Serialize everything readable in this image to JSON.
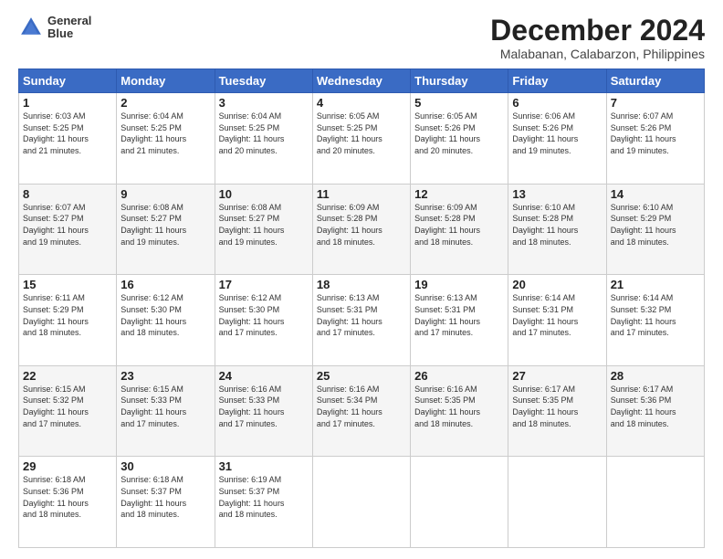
{
  "header": {
    "logo_line1": "General",
    "logo_line2": "Blue",
    "title": "December 2024",
    "subtitle": "Malabanan, Calabarzon, Philippines"
  },
  "calendar": {
    "days_of_week": [
      "Sunday",
      "Monday",
      "Tuesday",
      "Wednesday",
      "Thursday",
      "Friday",
      "Saturday"
    ],
    "weeks": [
      [
        {
          "day": 1,
          "info": "Sunrise: 6:03 AM\nSunset: 5:25 PM\nDaylight: 11 hours\nand 21 minutes."
        },
        {
          "day": 2,
          "info": "Sunrise: 6:04 AM\nSunset: 5:25 PM\nDaylight: 11 hours\nand 21 minutes."
        },
        {
          "day": 3,
          "info": "Sunrise: 6:04 AM\nSunset: 5:25 PM\nDaylight: 11 hours\nand 20 minutes."
        },
        {
          "day": 4,
          "info": "Sunrise: 6:05 AM\nSunset: 5:25 PM\nDaylight: 11 hours\nand 20 minutes."
        },
        {
          "day": 5,
          "info": "Sunrise: 6:05 AM\nSunset: 5:26 PM\nDaylight: 11 hours\nand 20 minutes."
        },
        {
          "day": 6,
          "info": "Sunrise: 6:06 AM\nSunset: 5:26 PM\nDaylight: 11 hours\nand 19 minutes."
        },
        {
          "day": 7,
          "info": "Sunrise: 6:07 AM\nSunset: 5:26 PM\nDaylight: 11 hours\nand 19 minutes."
        }
      ],
      [
        {
          "day": 8,
          "info": "Sunrise: 6:07 AM\nSunset: 5:27 PM\nDaylight: 11 hours\nand 19 minutes."
        },
        {
          "day": 9,
          "info": "Sunrise: 6:08 AM\nSunset: 5:27 PM\nDaylight: 11 hours\nand 19 minutes."
        },
        {
          "day": 10,
          "info": "Sunrise: 6:08 AM\nSunset: 5:27 PM\nDaylight: 11 hours\nand 19 minutes."
        },
        {
          "day": 11,
          "info": "Sunrise: 6:09 AM\nSunset: 5:28 PM\nDaylight: 11 hours\nand 18 minutes."
        },
        {
          "day": 12,
          "info": "Sunrise: 6:09 AM\nSunset: 5:28 PM\nDaylight: 11 hours\nand 18 minutes."
        },
        {
          "day": 13,
          "info": "Sunrise: 6:10 AM\nSunset: 5:28 PM\nDaylight: 11 hours\nand 18 minutes."
        },
        {
          "day": 14,
          "info": "Sunrise: 6:10 AM\nSunset: 5:29 PM\nDaylight: 11 hours\nand 18 minutes."
        }
      ],
      [
        {
          "day": 15,
          "info": "Sunrise: 6:11 AM\nSunset: 5:29 PM\nDaylight: 11 hours\nand 18 minutes."
        },
        {
          "day": 16,
          "info": "Sunrise: 6:12 AM\nSunset: 5:30 PM\nDaylight: 11 hours\nand 18 minutes."
        },
        {
          "day": 17,
          "info": "Sunrise: 6:12 AM\nSunset: 5:30 PM\nDaylight: 11 hours\nand 17 minutes."
        },
        {
          "day": 18,
          "info": "Sunrise: 6:13 AM\nSunset: 5:31 PM\nDaylight: 11 hours\nand 17 minutes."
        },
        {
          "day": 19,
          "info": "Sunrise: 6:13 AM\nSunset: 5:31 PM\nDaylight: 11 hours\nand 17 minutes."
        },
        {
          "day": 20,
          "info": "Sunrise: 6:14 AM\nSunset: 5:31 PM\nDaylight: 11 hours\nand 17 minutes."
        },
        {
          "day": 21,
          "info": "Sunrise: 6:14 AM\nSunset: 5:32 PM\nDaylight: 11 hours\nand 17 minutes."
        }
      ],
      [
        {
          "day": 22,
          "info": "Sunrise: 6:15 AM\nSunset: 5:32 PM\nDaylight: 11 hours\nand 17 minutes."
        },
        {
          "day": 23,
          "info": "Sunrise: 6:15 AM\nSunset: 5:33 PM\nDaylight: 11 hours\nand 17 minutes."
        },
        {
          "day": 24,
          "info": "Sunrise: 6:16 AM\nSunset: 5:33 PM\nDaylight: 11 hours\nand 17 minutes."
        },
        {
          "day": 25,
          "info": "Sunrise: 6:16 AM\nSunset: 5:34 PM\nDaylight: 11 hours\nand 17 minutes."
        },
        {
          "day": 26,
          "info": "Sunrise: 6:16 AM\nSunset: 5:35 PM\nDaylight: 11 hours\nand 18 minutes."
        },
        {
          "day": 27,
          "info": "Sunrise: 6:17 AM\nSunset: 5:35 PM\nDaylight: 11 hours\nand 18 minutes."
        },
        {
          "day": 28,
          "info": "Sunrise: 6:17 AM\nSunset: 5:36 PM\nDaylight: 11 hours\nand 18 minutes."
        }
      ],
      [
        {
          "day": 29,
          "info": "Sunrise: 6:18 AM\nSunset: 5:36 PM\nDaylight: 11 hours\nand 18 minutes."
        },
        {
          "day": 30,
          "info": "Sunrise: 6:18 AM\nSunset: 5:37 PM\nDaylight: 11 hours\nand 18 minutes."
        },
        {
          "day": 31,
          "info": "Sunrise: 6:19 AM\nSunset: 5:37 PM\nDaylight: 11 hours\nand 18 minutes."
        },
        null,
        null,
        null,
        null
      ]
    ]
  }
}
